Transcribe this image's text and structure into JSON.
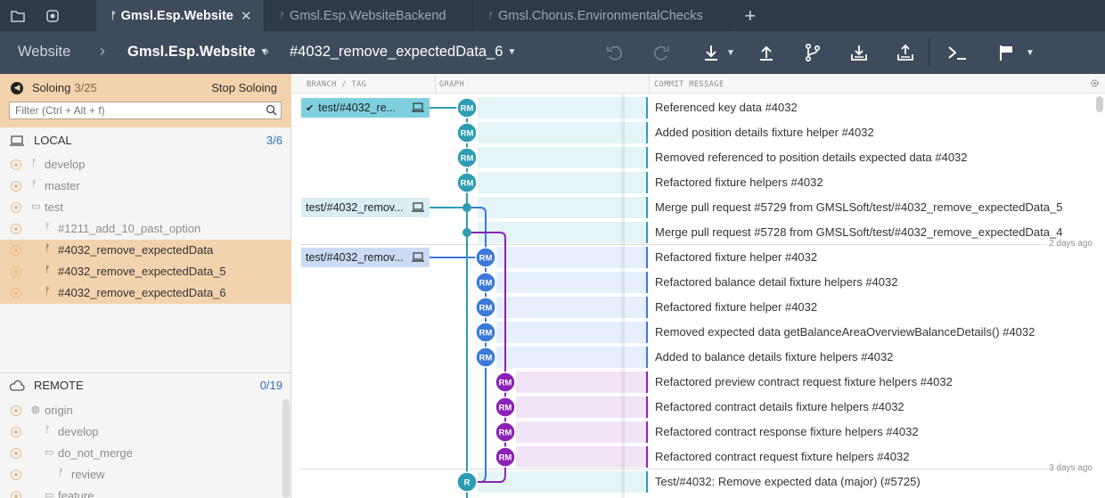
{
  "tabs": [
    {
      "label": "Gmsl.Esp.Website",
      "active": true
    },
    {
      "label": "Gmsl.Esp.WebsiteBackend",
      "active": false
    },
    {
      "label": "Gmsl.Chorus.EnvironmentalChecks",
      "active": false
    }
  ],
  "toolbar": {
    "repo_parent": "Website",
    "repo": "Gmsl.Esp.Website",
    "branch": "#4032_remove_expectedData_6",
    "buttons": [
      "undo-icon",
      "redo-icon",
      "pull-icon",
      "push-icon",
      "branch-icon",
      "stash-icon",
      "pop-icon",
      "terminal-icon",
      "flag-icon"
    ]
  },
  "left": {
    "solo_label": "Soloing",
    "solo_count": "3/25",
    "stop_label": "Stop Soloing",
    "filter_placeholder": "Filter (Ctrl + Alt + f)",
    "local": {
      "label": "LOCAL",
      "count": "3/6"
    },
    "local_items": [
      {
        "text": "develop",
        "kind": "branch",
        "highlight": false
      },
      {
        "text": "master",
        "kind": "branch",
        "highlight": false
      },
      {
        "text": "test",
        "kind": "folder",
        "highlight": false
      },
      {
        "text": "#1211_add_10_past_option",
        "kind": "branch",
        "highlight": false
      },
      {
        "text": "#4032_remove_expectedData",
        "kind": "branch",
        "highlight": true
      },
      {
        "text": "#4032_remove_expectedData_5",
        "kind": "branch",
        "highlight": true
      },
      {
        "text": "#4032_remove_expectedData_6",
        "kind": "branch",
        "highlight": true
      }
    ],
    "remote": {
      "label": "REMOTE",
      "count": "0/19"
    },
    "remote_items": [
      {
        "text": "origin",
        "kind": "repo"
      },
      {
        "text": "develop",
        "kind": "branch"
      },
      {
        "text": "do_not_merge",
        "kind": "folder"
      },
      {
        "text": "review",
        "kind": "branch"
      },
      {
        "text": "feature",
        "kind": "folder"
      }
    ]
  },
  "graph": {
    "headers": {
      "branch": "BRANCH / TAG",
      "graph": "GRAPH",
      "message": "COMMIT MESSAGE"
    },
    "branch_tags": [
      {
        "text": "test/#4032_re...",
        "checked": true
      },
      {
        "text": "test/#4032_remov...",
        "checked": false
      },
      {
        "text": "test/#4032_remov...",
        "checked": false
      }
    ],
    "day_labels": [
      "2 days ago",
      "3 days ago"
    ],
    "commits": [
      {
        "msg": "Referenced key data #4032",
        "avatar": "RM",
        "lane": "teal"
      },
      {
        "msg": "Added position details fixture helper #4032",
        "avatar": "RM",
        "lane": "teal"
      },
      {
        "msg": "Removed referenced to position details expected data #4032",
        "avatar": "RM",
        "lane": "teal"
      },
      {
        "msg": "Refactored fixture helpers #4032",
        "avatar": "RM",
        "lane": "teal"
      },
      {
        "msg": "Merge pull request #5729 from GMSLSoft/test/#4032_remove_expectedData_5",
        "avatar": "",
        "lane": "teal"
      },
      {
        "msg": "Merge pull request #5728 from GMSLSoft/test/#4032_remove_expectedData_4",
        "avatar": "",
        "lane": "teal"
      },
      {
        "msg": "Refactored fixture helper #4032",
        "avatar": "RM",
        "lane": "blue"
      },
      {
        "msg": "Refactored balance detail fixture helpers #4032",
        "avatar": "RM",
        "lane": "blue"
      },
      {
        "msg": "Refactored fixture helper #4032",
        "avatar": "RM",
        "lane": "blue"
      },
      {
        "msg": "Removed expected data getBalanceAreaOverviewBalanceDetails() #4032",
        "avatar": "RM",
        "lane": "blue"
      },
      {
        "msg": "Added to balance details fixture helpers #4032",
        "avatar": "RM",
        "lane": "blue"
      },
      {
        "msg": "Refactored preview contract request fixture helpers #4032",
        "avatar": "RM",
        "lane": "purple"
      },
      {
        "msg": "Refactored contract details fixture helpers #4032",
        "avatar": "RM",
        "lane": "purple"
      },
      {
        "msg": "Refactored contract response fixture helpers #4032",
        "avatar": "RM",
        "lane": "purple"
      },
      {
        "msg": "Refactored contract request fixture helpers #4032",
        "avatar": "RM",
        "lane": "purple"
      },
      {
        "msg": "Test/#4032: Remove expected data (major) (#5725)",
        "avatar": "R",
        "lane": "teal"
      }
    ]
  },
  "colors": {
    "teal": "#2e9db3",
    "blue": "#3b78d8",
    "purple": "#8b22b5",
    "solo_bg": "#f3d3ae",
    "toolbar": "#3e4b5c"
  }
}
